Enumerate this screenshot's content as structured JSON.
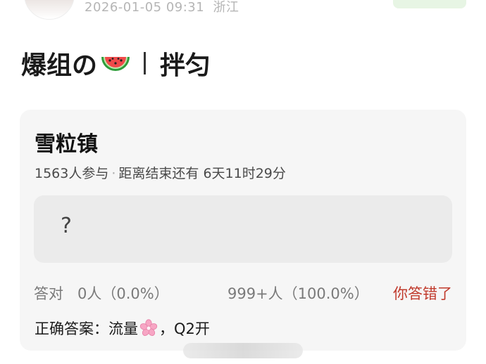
{
  "post": {
    "timestamp": "2026-01-05 09:31",
    "location": "浙江",
    "title_part1": "爆组の",
    "title_part2": "拌匀"
  },
  "poll": {
    "title": "雪粒镇",
    "participants": "1563人参与",
    "separator": "·",
    "countdown": "距离结束还有 6天11时29分",
    "option_text": "?",
    "correct_label": "答对",
    "correct_count": "0人（0.0%）",
    "wrong_count": "999+人（100.0%）",
    "result_text": "你答错了",
    "answer_prefix": "正确答案：流量",
    "answer_suffix": "，Q2开"
  },
  "icons": {
    "title_emoji": "watermelon-icon",
    "answer_emoji": "cherry-blossom-icon"
  },
  "colors": {
    "wrong_result": "#c0392b",
    "card_bg": "#f6f6f6",
    "option_bg": "#ebebeb"
  }
}
